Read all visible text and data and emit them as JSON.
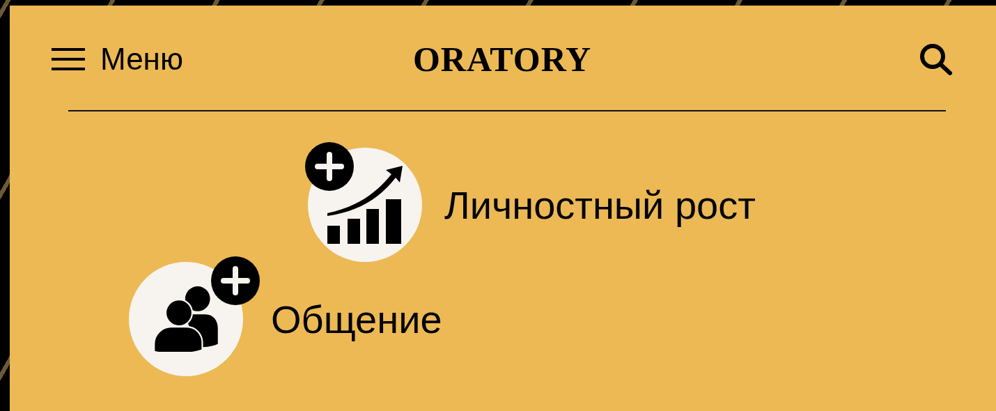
{
  "header": {
    "menu_label": "Меню",
    "title": "ORATORY"
  },
  "topics": [
    {
      "kind": "growth",
      "label": "Личностный рост"
    },
    {
      "kind": "people",
      "label": "Общение"
    }
  ]
}
